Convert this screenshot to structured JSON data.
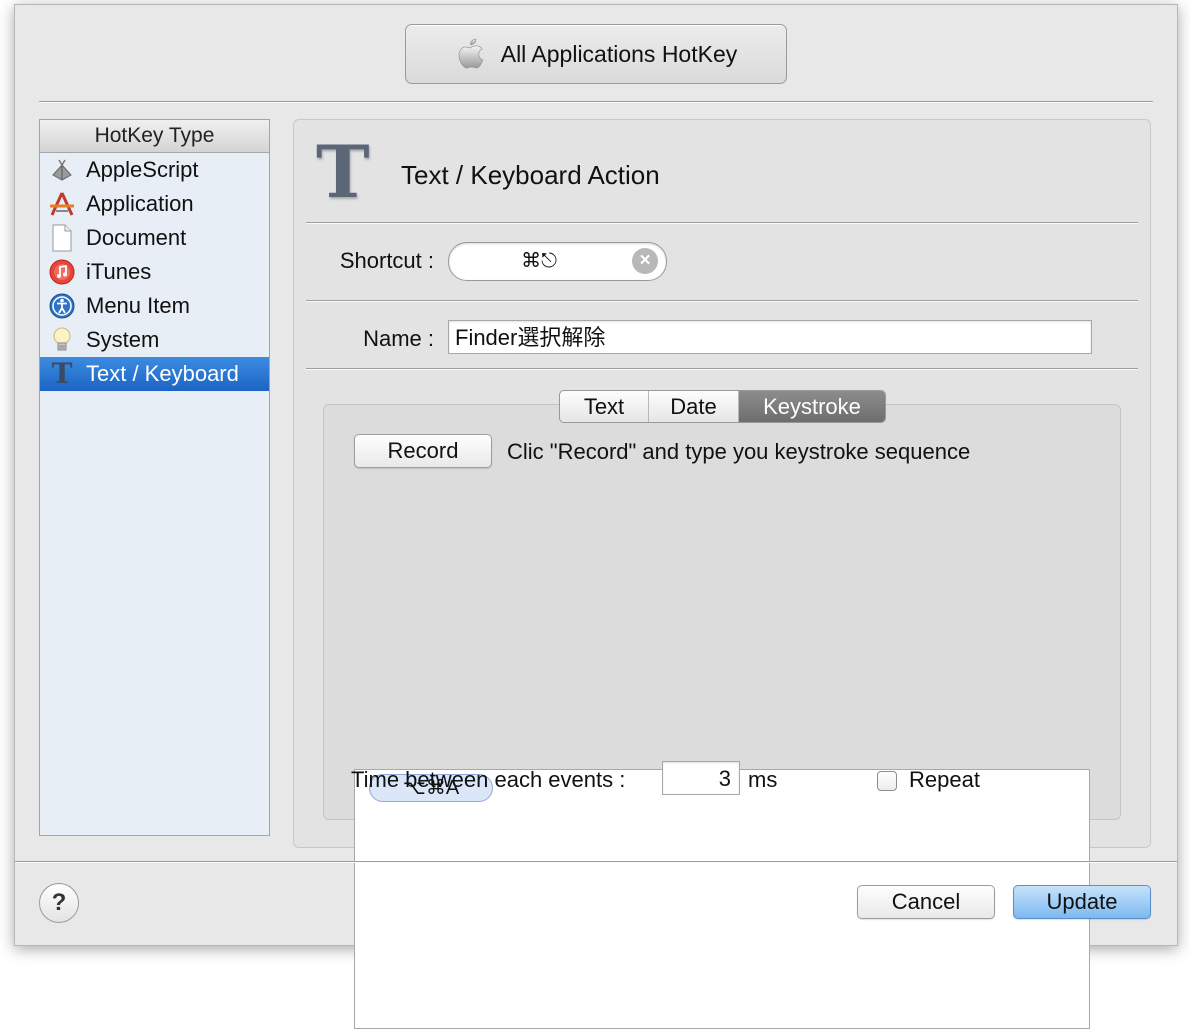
{
  "header": {
    "app_selector_label": "All Applications HotKey"
  },
  "sidebar": {
    "header": "HotKey Type",
    "items": [
      {
        "label": "AppleScript",
        "icon": "applescript-icon"
      },
      {
        "label": "Application",
        "icon": "application-icon"
      },
      {
        "label": "Document",
        "icon": "document-icon"
      },
      {
        "label": "iTunes",
        "icon": "itunes-icon"
      },
      {
        "label": "Menu Item",
        "icon": "menu-item-icon"
      },
      {
        "label": "System",
        "icon": "lightbulb-icon"
      },
      {
        "label": "Text / Keyboard",
        "icon": "text-t-icon",
        "selected": true
      }
    ]
  },
  "action": {
    "icon_glyph": "T",
    "title": "Text / Keyboard Action",
    "shortcut_label": "Shortcut :",
    "shortcut_value": "⌘⎋",
    "name_label": "Name :",
    "name_value": "Finder選択解除"
  },
  "tabs": [
    {
      "label": "Text",
      "active": false
    },
    {
      "label": "Date",
      "active": false
    },
    {
      "label": "Keystroke",
      "active": true
    }
  ],
  "keystroke": {
    "record_label": "Record",
    "instruction": "Clic \"Record\" and type you keystroke sequence",
    "sequence": [
      "⌥⌘A"
    ],
    "time_label": "Time between each events :",
    "time_value": "3",
    "time_unit": "ms",
    "repeat_label": "Repeat",
    "repeat_checked": false
  },
  "footer": {
    "help_label": "?",
    "cancel_label": "Cancel",
    "update_label": "Update"
  },
  "colors": {
    "selection": "#2a74d4",
    "primary_button": "#8fc2f2"
  }
}
